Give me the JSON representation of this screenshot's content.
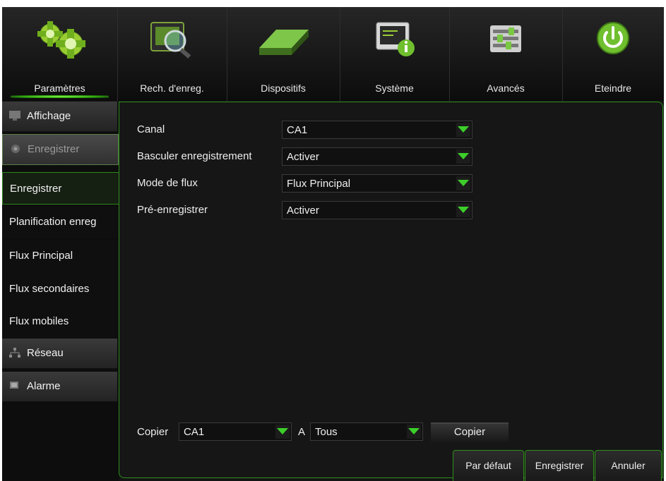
{
  "nav": {
    "items": [
      {
        "label": "Paramètres",
        "icon": "gears-icon"
      },
      {
        "label": "Rech. d'enreg.",
        "icon": "record-search-icon"
      },
      {
        "label": "Dispositifs",
        "icon": "hard-drive-icon"
      },
      {
        "label": "Système",
        "icon": "system-info-icon"
      },
      {
        "label": "Avancés",
        "icon": "sliders-icon"
      },
      {
        "label": "Eteindre",
        "icon": "power-icon"
      }
    ],
    "active": "Paramètres"
  },
  "sidebar": {
    "cat_affichage": "Affichage",
    "cat_enregistrer": "Enregistrer",
    "sub": [
      "Enregistrer",
      "Planification enreg",
      "Flux Principal",
      "Flux secondaires",
      "Flux mobiles"
    ],
    "cat_reseau": "Réseau",
    "cat_alarme": "Alarme"
  },
  "form": {
    "canal_label": "Canal",
    "canal_value": "CA1",
    "basculer_label": "Basculer enregistrement",
    "basculer_value": "Activer",
    "mode_label": "Mode de flux",
    "mode_value": "Flux Principal",
    "pre_label": "Pré-enregistrer",
    "pre_value": "Activer"
  },
  "copy": {
    "label": "Copier",
    "from_value": "CA1",
    "to_label": "A",
    "to_value": "Tous",
    "button": "Copier"
  },
  "footer": {
    "default_button": "Par défaut",
    "save_button": "Enregistrer",
    "cancel_button": "Annuler"
  },
  "colors": {
    "accent": "#2f8f1c",
    "dropdown_arrow": "#3ccf2a",
    "background": "#141414"
  }
}
